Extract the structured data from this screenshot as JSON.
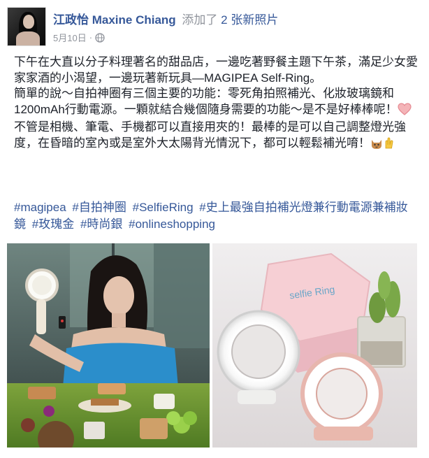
{
  "post": {
    "author": "江政怡 Maxine Chiang",
    "action_prefix": "添加了",
    "photo_count": "2",
    "action_suffix": "张新照片",
    "date": "5月10日",
    "separator": "·",
    "privacy_icon": "globe-icon"
  },
  "body": {
    "p1": "下午在大直以分子料理著名的甜品店，一邊吃著野餐主題下午茶，滿足少女愛家家酒的小渴望，一邊玩著新玩具—MAGIPEA Self-Ring。",
    "p2": "簡單的說～自拍神圈有三個主要的功能：零死角拍照補光、化妝玻璃鏡和1200mAh行動電源。一顆就結合幾個隨身需要的功能～是不是好棒棒呢！",
    "p3": "不管是相機、筆電、手機都可以直接用夾的！最棒的是可以自己調整燈光強度，在昏暗的室內或是室外大太陽背光情況下，都可以輕鬆補光唷！"
  },
  "hashtags": [
    "#magipea",
    "#自拍神圈",
    "#SelfieRing",
    "#史上最強自拍補光燈兼行動電源兼補妝鏡",
    "#玫瑰金",
    "#時尚銀"
  ],
  "hashtag_last": "#onlineshopping",
  "product_box_text": "selfie Ring",
  "colors": {
    "link": "#365899",
    "meta": "#90949c",
    "text": "#1d2129"
  }
}
